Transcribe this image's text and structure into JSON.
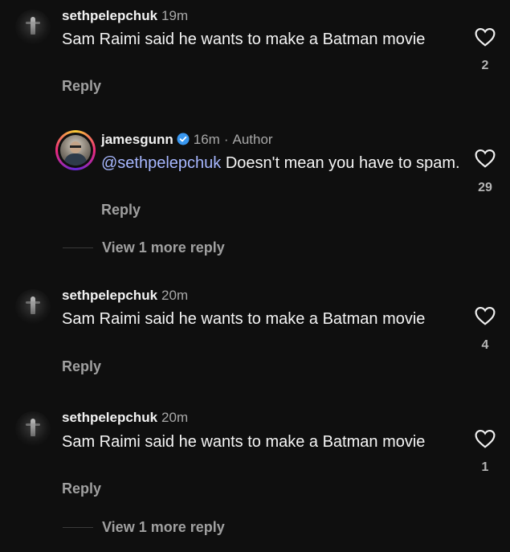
{
  "comments": [
    {
      "username": "sethpelepchuk",
      "time": "19m",
      "text": "Sam Raimi said he wants to make a Batman movie",
      "reply_label": "Reply",
      "likes": "2"
    },
    {
      "username": "jamesgunn",
      "time": "16m",
      "dot": "·",
      "author_label": "Author",
      "mention": "@sethpelepchuk",
      "text": " Doesn't mean you have to spam.",
      "reply_label": "Reply",
      "likes": "29"
    },
    {
      "username": "sethpelepchuk",
      "time": "20m",
      "text": "Sam Raimi said he wants to make a Batman movie",
      "reply_label": "Reply",
      "likes": "4"
    },
    {
      "username": "sethpelepchuk",
      "time": "20m",
      "text": "Sam Raimi said he wants to make a Batman movie",
      "reply_label": "Reply",
      "likes": "1"
    }
  ],
  "view_more_1": "View 1 more reply",
  "view_more_2": "View 1 more reply",
  "colors": {
    "background": "#0f0f0f",
    "mention": "#a7b7ff",
    "verified": "#3897f0"
  },
  "icons": {
    "like": "heart-outline-icon",
    "verified": "verified-badge-icon"
  }
}
